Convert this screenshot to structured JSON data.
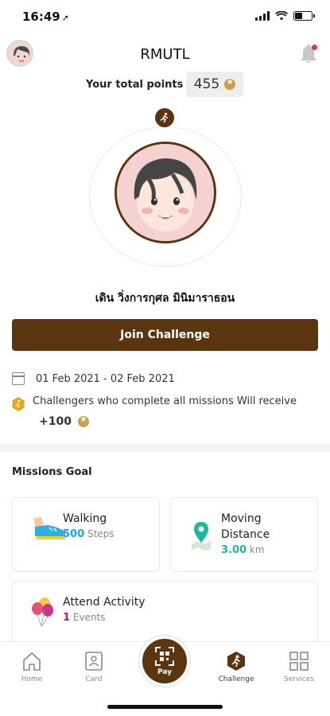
{
  "status_bar": {
    "time": "16:49"
  },
  "header": {
    "title": "RMUTL"
  },
  "points": {
    "label": "Your total points",
    "value": "455"
  },
  "profile": {
    "name": "เดิน วิ่งการกุศล มินิมาราธอน"
  },
  "join_button": {
    "label": "Join Challenge"
  },
  "challenge": {
    "date_range": "01 Feb 2021 - 02 Feb 2021",
    "reward_text": "Challengers who complete all missions  Will receive",
    "reward_amount": "+100"
  },
  "missions": {
    "title": "Missions Goal",
    "items": [
      {
        "name": "Walking",
        "value": "500",
        "unit": "Steps",
        "color": "#1ba6e0"
      },
      {
        "name_line1": "Moving",
        "name_line2": "Distance",
        "value": "3.00",
        "unit": "km",
        "color": "#1fb5a3"
      },
      {
        "name": "Attend Activity",
        "value": "1",
        "unit": "Events",
        "color": "#b0208c"
      }
    ]
  },
  "tabbar": {
    "items": [
      {
        "label": "Home",
        "icon": "home-icon"
      },
      {
        "label": "Card",
        "icon": "card-icon"
      },
      {
        "label": "Pay",
        "icon": "qr-scan-icon"
      },
      {
        "label": "Challenge",
        "icon": "challenge-icon",
        "active": true
      },
      {
        "label": "Services",
        "icon": "grid-icon"
      }
    ]
  },
  "colors": {
    "brand": "#5b3410",
    "accent_gold": "#c9a24c",
    "notification": "#e23a3a"
  }
}
